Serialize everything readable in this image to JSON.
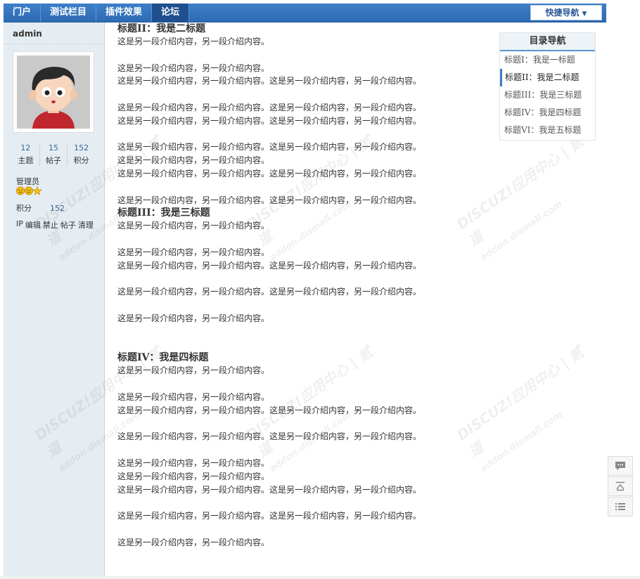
{
  "nav": {
    "items": [
      "门户",
      "测试栏目",
      "插件效果",
      "论坛"
    ],
    "active_index": 3,
    "quick_nav_label": "快捷导航"
  },
  "sidebar": {
    "username": "admin",
    "stats": [
      {
        "value": "12",
        "label": "主题"
      },
      {
        "value": "15",
        "label": "帖子"
      },
      {
        "value": "152",
        "label": "积分"
      }
    ],
    "role": "管理员",
    "score_label": "积分",
    "score_value": "152",
    "actions": [
      "IP",
      "编辑",
      "禁止",
      "帖子",
      "清理"
    ]
  },
  "content": {
    "blocks": [
      {
        "heading": "标题II：我是二标题",
        "lines": [
          "这是另一段介绍内容，另一段介绍内容。",
          "",
          "这是另一段介绍内容，另一段介绍内容。",
          "这是另一段介绍内容，另一段介绍内容。这是另一段介绍内容，另一段介绍内容。",
          "",
          "这是另一段介绍内容，另一段介绍内容。这是另一段介绍内容，另一段介绍内容。",
          "这是另一段介绍内容，另一段介绍内容。这是另一段介绍内容，另一段介绍内容。",
          "",
          "这是另一段介绍内容，另一段介绍内容。这是另一段介绍内容，另一段介绍内容。",
          "这是另一段介绍内容，另一段介绍内容。",
          "这是另一段介绍内容，另一段介绍内容。这是另一段介绍内容，另一段介绍内容。",
          "",
          "这是另一段介绍内容，另一段介绍内容。这是另一段介绍内容，另一段介绍内容。"
        ]
      },
      {
        "heading": "标题III：我是三标题",
        "lines": [
          "这是另一段介绍内容，另一段介绍内容。",
          "",
          "这是另一段介绍内容，另一段介绍内容。",
          "这是另一段介绍内容，另一段介绍内容。这是另一段介绍内容，另一段介绍内容。",
          "",
          "这是另一段介绍内容，另一段介绍内容。这是另一段介绍内容，另一段介绍内容。",
          "",
          "这是另一段介绍内容，另一段介绍内容。",
          "",
          ""
        ]
      },
      {
        "heading": "标题IV：我是四标题",
        "lines": [
          "这是另一段介绍内容，另一段介绍内容。",
          "",
          "这是另一段介绍内容，另一段介绍内容。",
          "这是另一段介绍内容，另一段介绍内容。这是另一段介绍内容，另一段介绍内容。",
          "",
          "这是另一段介绍内容，另一段介绍内容。这是另一段介绍内容，另一段介绍内容。",
          "",
          "这是另一段介绍内容，另一段介绍内容。",
          "这是另一段介绍内容，另一段介绍内容。",
          "这是另一段介绍内容，另一段介绍内容。这是另一段介绍内容，另一段介绍内容。",
          "",
          "这是另一段介绍内容，另一段介绍内容。这是另一段介绍内容，另一段介绍内容。",
          "",
          "这是另一段介绍内容，另一段介绍内容。",
          ""
        ]
      }
    ]
  },
  "toc": {
    "title": "目录导航",
    "items": [
      "标题I：我是一标题",
      "标题II：我是二标题",
      "标题III：我是三标题",
      "标题IV：我是四标题",
      "标题VI：我是五标题"
    ],
    "active_index": 1
  },
  "watermark": {
    "text": "DISCUZ!应用中心 | 贰道",
    "subtext": "addon.dismall.com"
  },
  "tools": [
    {
      "icon": "comment-icon"
    },
    {
      "icon": "back-to-top-icon"
    },
    {
      "icon": "list-icon"
    }
  ],
  "colors": {
    "accent": "#2d6bb3",
    "link": "#336699"
  }
}
